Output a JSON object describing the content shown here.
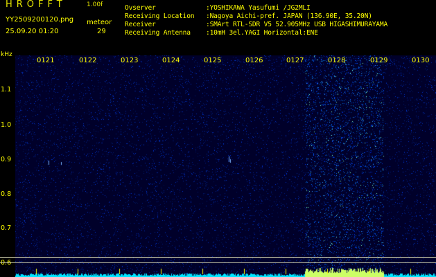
{
  "header": {
    "logo": "HROFFT",
    "version": "1.00f",
    "filename": "YY2509200120.png",
    "datetime": "25.09.20 01:20",
    "meteor_label": "meteor",
    "meteor_count": "29"
  },
  "info": [
    {
      "key": "Ovserver",
      "value": ":YOSHIKAWA Yasufumi /JG2MLI"
    },
    {
      "key": "Receiving Location",
      "value": ":Nagoya Aichi-pref. JAPAN (136.90E, 35.20N)"
    },
    {
      "key": "Receiver",
      "value": ":SMArt RTL-SDR V5 52.905MHz USB HIGASHIMURAYAMA"
    },
    {
      "key": "Receiving Antenna",
      "value": ":10mH 3el.YAGI Horizontal:ENE"
    }
  ],
  "axis": {
    "unit": "kHz",
    "y_labels": [
      "1.1",
      "1.0",
      "0.9",
      "0.8",
      "0.7",
      "0.6"
    ],
    "x_labels": [
      "0121",
      "0122",
      "0123",
      "0124",
      "0125",
      "0126",
      "0127",
      "0128",
      "0129",
      "0130"
    ]
  },
  "colors": {
    "text": "#ffff00",
    "background": "#000000",
    "noise_base": "#00002a",
    "highlight_band": "#0033ff",
    "baseline": "#00ffff"
  }
}
